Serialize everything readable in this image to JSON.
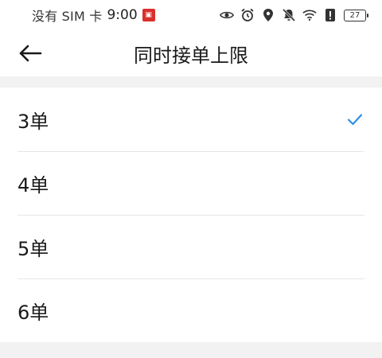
{
  "status_bar": {
    "carrier": "没有 SIM 卡",
    "time": "9:00",
    "notification_icon": "app-notification-icon",
    "icons": [
      "eye-icon",
      "alarm-icon",
      "location-icon",
      "mute-icon",
      "wifi-icon",
      "alert-icon"
    ],
    "battery_level": "27"
  },
  "header": {
    "back_icon": "arrow-left-icon",
    "title": "同时接单上限"
  },
  "options": [
    {
      "label": "3单",
      "selected": true
    },
    {
      "label": "4单",
      "selected": false
    },
    {
      "label": "5单",
      "selected": false
    },
    {
      "label": "6单",
      "selected": false
    }
  ],
  "colors": {
    "accent": "#2f8de4",
    "background": "#f2f2f2",
    "surface": "#ffffff",
    "divider": "#e6e6e6"
  }
}
